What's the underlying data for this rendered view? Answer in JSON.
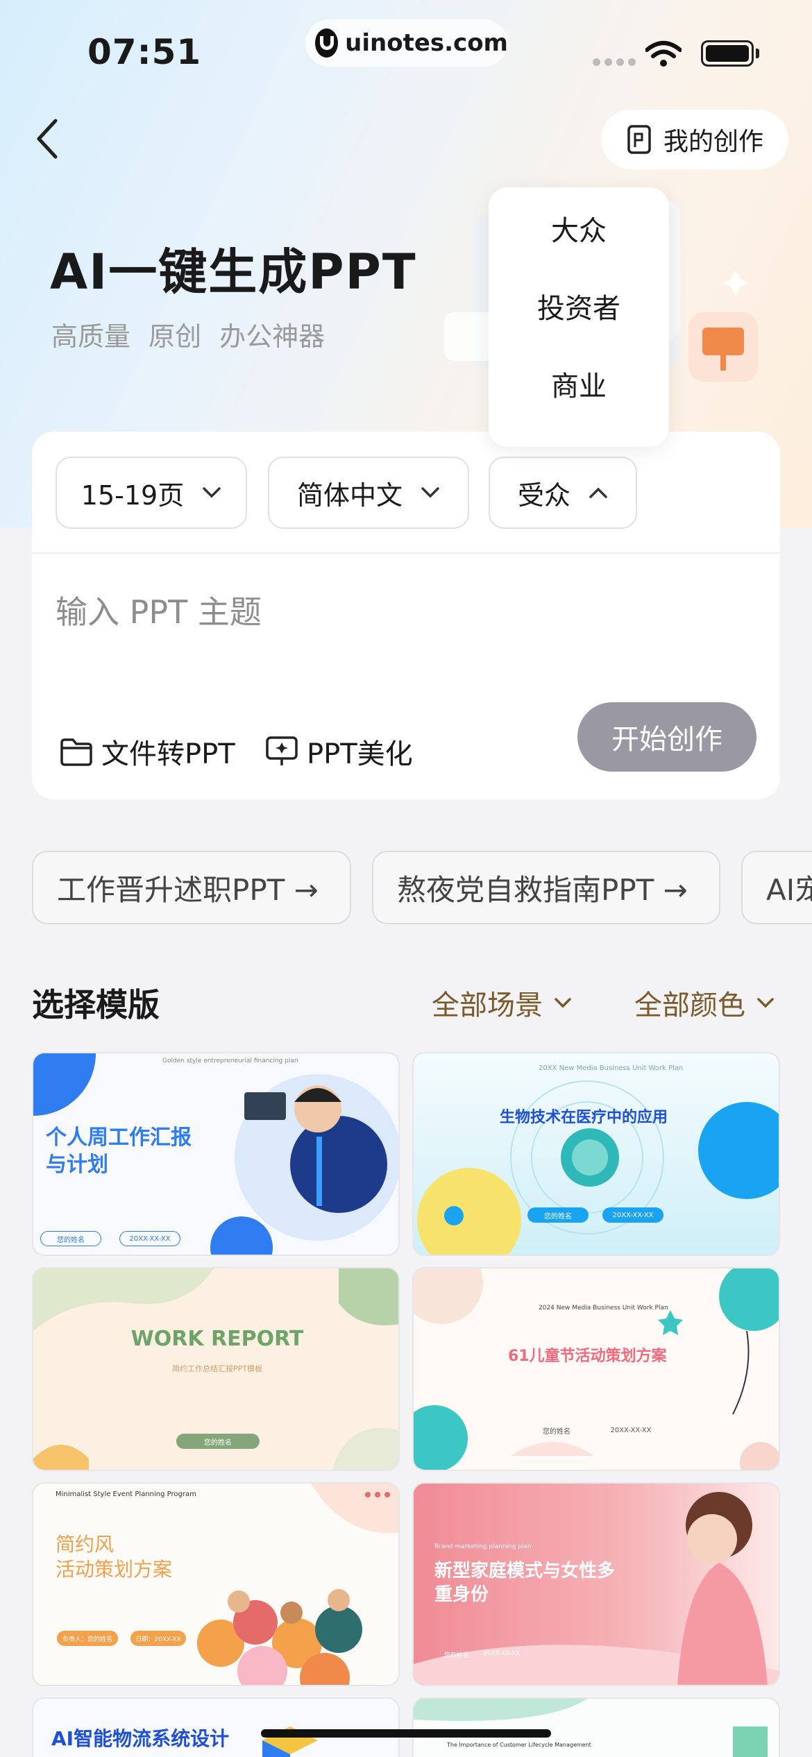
{
  "status_bar": {
    "time": "07:51",
    "url": "uinotes.com"
  },
  "header": {
    "my_creations_label": "我的创作"
  },
  "hero": {
    "title": "AI一键生成PPT",
    "subtitle": "高质量  原创  办公神器"
  },
  "options": {
    "pages": "15-19页",
    "language": "简体中文",
    "audience": "受众"
  },
  "audience_dropdown": [
    "大众",
    "投资者",
    "商业"
  ],
  "input": {
    "placeholder": "输入 PPT 主题"
  },
  "tools": {
    "file_to_ppt": "文件转PPT",
    "ppt_beautify": "PPT美化"
  },
  "start_button": "开始创作",
  "suggestions": [
    "工作晋升述职PPT →",
    "熬夜党自救指南PPT →",
    "AI宠"
  ],
  "templates_section": {
    "title": "选择模版",
    "filter_scene": "全部场景",
    "filter_color": "全部颜色"
  },
  "templates": [
    {
      "title": "个人周工作汇报\n与计划",
      "caption": "Golden style entrepreneurial financing plan",
      "name_label": "您的姓名",
      "date_label": "20XX-XX-XX"
    },
    {
      "title": "生物技术在医疗中的应用",
      "caption": "20XX New Media Business Unit Work Plan",
      "name_label": "您的姓名",
      "date_label": "20XX-XX-XX"
    },
    {
      "title": "WORK REPORT",
      "caption": "简约工作总结汇报PPT模板",
      "name_label": "您的姓名"
    },
    {
      "title": "61儿童节活动策划方案",
      "caption": "2024 New Media Business Unit Work Plan",
      "name_label": "您的姓名",
      "date_label": "20XX-XX-XX"
    },
    {
      "title": "简约风\n活动策划方案",
      "caption": "Minimalist Style Event Planning Program",
      "name_label": "负责人：您的姓名",
      "date_label": "日期：20XX-XX"
    },
    {
      "title": "新型家庭模式与女性多\n重身份",
      "caption": "Brand marketing planning plan",
      "name_label": "您的姓名",
      "date_label": "20XX-XX-XX"
    },
    {
      "title": "AI智能物流系统设计",
      "caption": ""
    },
    {
      "title": "",
      "caption": "The Importance of Customer Lifecycle Management"
    }
  ],
  "colors": {
    "accent_brown": "#7a5a2a",
    "start_button": "#9a98a3",
    "blue": "#2f7cf0"
  }
}
